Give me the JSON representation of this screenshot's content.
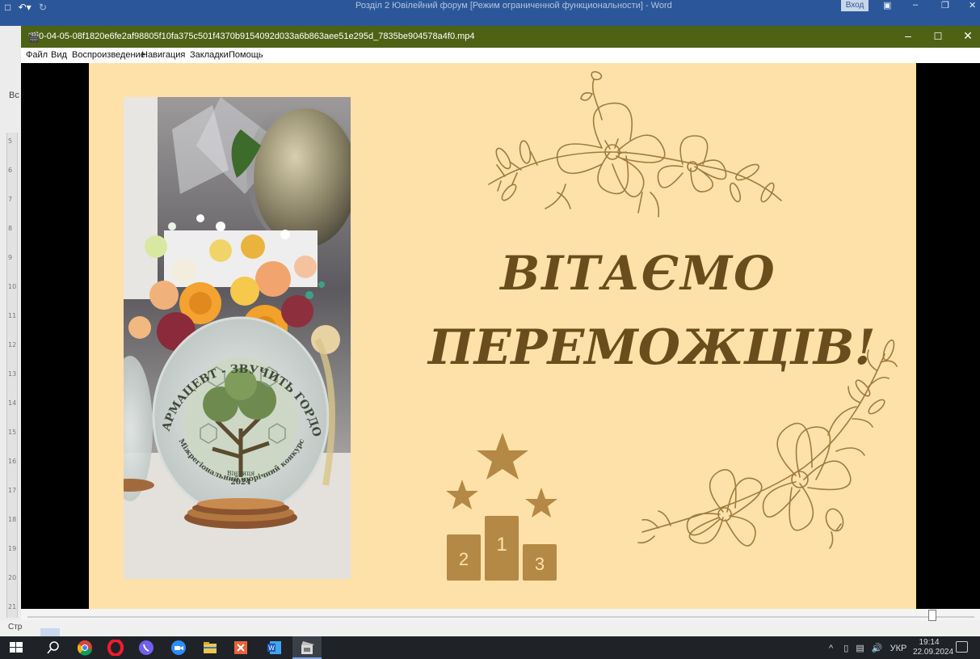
{
  "word": {
    "title": "Розділ 2 Ювілейний форум [Режим ограниченной функциональности] - Word",
    "login_label": "Вход",
    "left_tab_label": "Вс",
    "status_page": "Стр",
    "ruler_numbers": [
      "5",
      "6",
      "7",
      "8",
      "9",
      "10",
      "11",
      "12",
      "13",
      "14",
      "15",
      "16",
      "17",
      "18",
      "19",
      "20",
      "21"
    ]
  },
  "player": {
    "filename": "0-04-05-08f1820e6fe2af98805f10fa375c501f4370b9154092d033a6b863aee51e295d_7835be904578a4f0.mp4",
    "menu": [
      "Файл",
      "Вид",
      "Воспроизведение",
      "Навигация",
      "Закладки",
      "Помощь"
    ],
    "progress_fraction": 0.955
  },
  "slide": {
    "line1": "ВІТАЄМО",
    "line2": "ПЕРЕМОЖЦІВ!",
    "podium": [
      "1",
      "2",
      "3"
    ],
    "photo_award": {
      "arc_text": "ФАРМАЦЕВТ - ЗВУЧИТЬ ГОРДО!",
      "bottom_arc_text": "Міжрегіональний щорічний конкурс",
      "city": "Вінниця",
      "year": "2024"
    },
    "colors": {
      "background": "#fde1a8",
      "text": "#6b4d1d",
      "podium": "#b48945",
      "line_art": "#a17b3e"
    }
  },
  "taskbar": {
    "language": "УКР",
    "time": "19:14",
    "date": "22.09.2024",
    "apps": [
      "windows-start-icon",
      "search-icon",
      "chrome-icon",
      "opera-icon",
      "viber-icon",
      "zoom-icon",
      "file-explorer-icon",
      "reader-icon",
      "word-icon",
      "media-player-icon"
    ]
  }
}
